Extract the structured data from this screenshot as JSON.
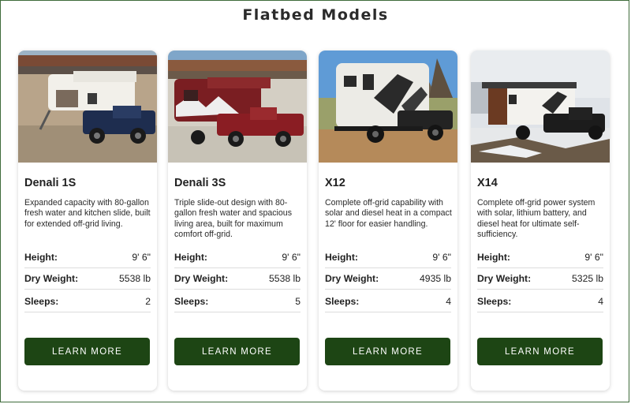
{
  "page": {
    "title": "Flatbed Models"
  },
  "colors": {
    "button": "#1d4514",
    "frame_border": "#3e6b3a"
  },
  "cards": [
    {
      "name": "Denali 1S",
      "description": "Expanded capacity with 80-gallon fresh water and kitchen slide, built for extended off-grid living.",
      "specs": [
        {
          "label": "Height:",
          "value": "9' 6\""
        },
        {
          "label": "Dry Weight:",
          "value": "5538 lb"
        },
        {
          "label": "Sleeps:",
          "value": "2"
        }
      ],
      "button": "LEARN MORE"
    },
    {
      "name": "Denali 3S",
      "description": "Triple slide-out design with 80-gallon fresh water and spacious living area, built for maximum comfort off-grid.",
      "specs": [
        {
          "label": "Height:",
          "value": "9' 6\""
        },
        {
          "label": "Dry Weight:",
          "value": "5538 lb"
        },
        {
          "label": "Sleeps:",
          "value": "5"
        }
      ],
      "button": "LEARN MORE"
    },
    {
      "name": "X12",
      "description": "Complete off-grid capability with solar and diesel heat in a compact 12' floor for easier handling.",
      "specs": [
        {
          "label": "Height:",
          "value": "9' 6\""
        },
        {
          "label": "Dry Weight:",
          "value": "4935 lb"
        },
        {
          "label": "Sleeps:",
          "value": "4"
        }
      ],
      "button": "LEARN MORE"
    },
    {
      "name": "X14",
      "description": "Complete off-grid power system with solar, lithium battery, and diesel heat for ultimate self-sufficiency.",
      "specs": [
        {
          "label": "Height:",
          "value": "9' 6\""
        },
        {
          "label": "Dry Weight:",
          "value": "5325 lb"
        },
        {
          "label": "Sleeps:",
          "value": "4"
        }
      ],
      "button": "LEARN MORE"
    }
  ]
}
